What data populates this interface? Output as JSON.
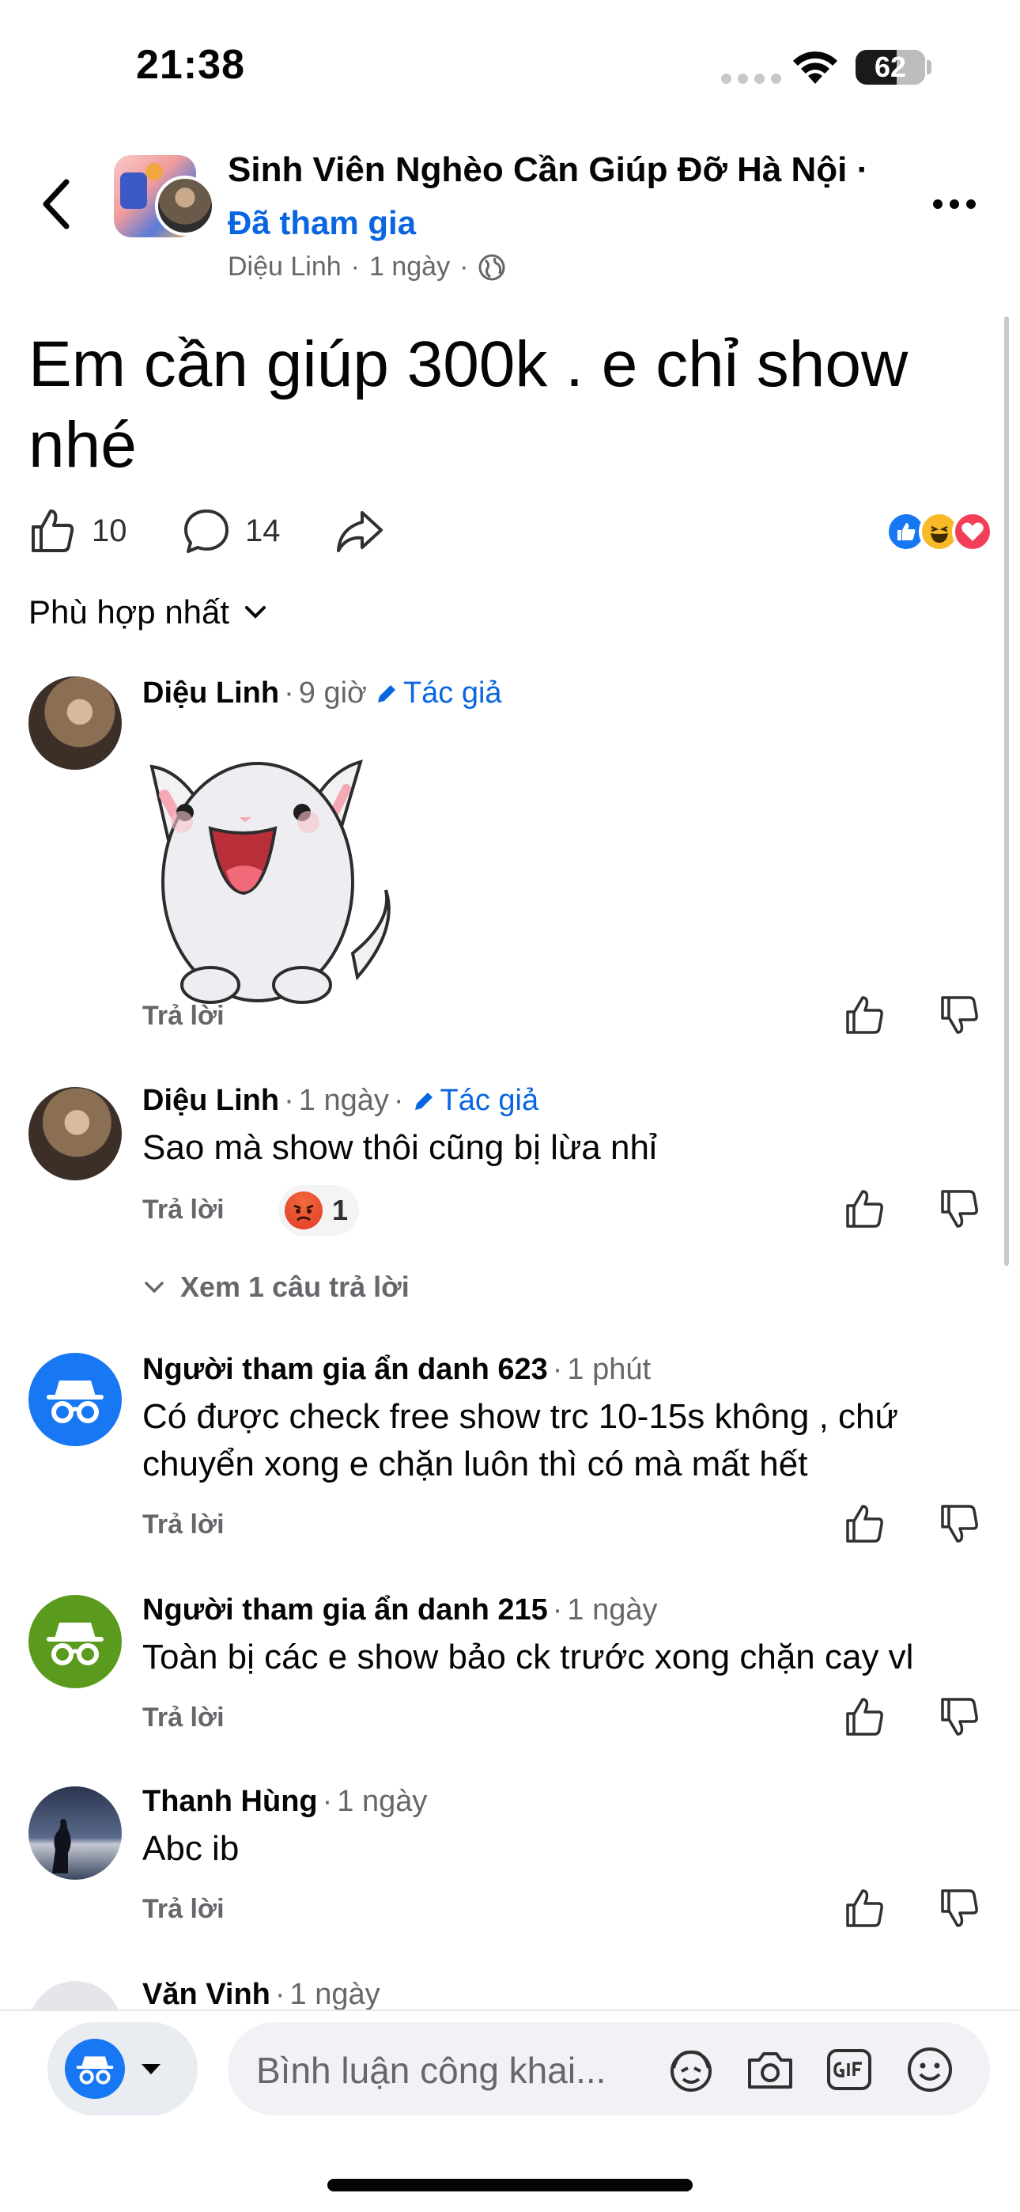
{
  "status": {
    "time": "21:38",
    "battery": "62"
  },
  "header": {
    "group_name": "Sinh Viên Nghèo Cần Giúp Đỡ Hà Nội ·",
    "joined": "Đã tham gia",
    "author": "Diệu Linh",
    "post_time": "1 ngày"
  },
  "post": {
    "title": "Em cần giúp 300k . e chỉ show nhé",
    "likes": "10",
    "comments": "14"
  },
  "sort": {
    "label": "Phù hợp nhất"
  },
  "comments": [
    {
      "name": "Diệu Linh",
      "time": "9 giờ",
      "author_badge": "Tác giả",
      "text": "",
      "reply": "Trả lời",
      "sticker": "white-bunny-sticker"
    },
    {
      "name": "Diệu Linh",
      "time": "1 ngày",
      "author_badge": "Tác giả",
      "text": "Sao mà show thôi cũng bị lừa nhỉ",
      "reply": "Trả lời",
      "reaction_count": "1",
      "view_replies": "Xem 1 câu trả lời"
    },
    {
      "name": "Người tham gia ẩn danh 623",
      "time": "1 phút",
      "text": "Có được check free show trc 10-15s không , chứ chuyển xong e chặn luôn thì có mà mất hết",
      "reply": "Trả lời",
      "avatar_color": "#1877f2"
    },
    {
      "name": "Người tham gia ẩn danh 215",
      "time": "1 ngày",
      "text": "Toàn bị các e show bảo ck trước xong chặn cay vl",
      "reply": "Trả lời",
      "avatar_color": "#5a9a1c"
    },
    {
      "name": "Thanh Hùng",
      "time": "1 ngày",
      "text": "Abc ib",
      "reply": "Trả lời"
    },
    {
      "name": "Văn Vinh",
      "time": "1 ngày"
    }
  ],
  "composer": {
    "placeholder": "Bình luận công khai..."
  },
  "colors": {
    "accent": "#0a66e0",
    "secondary_text": "#65676b"
  }
}
